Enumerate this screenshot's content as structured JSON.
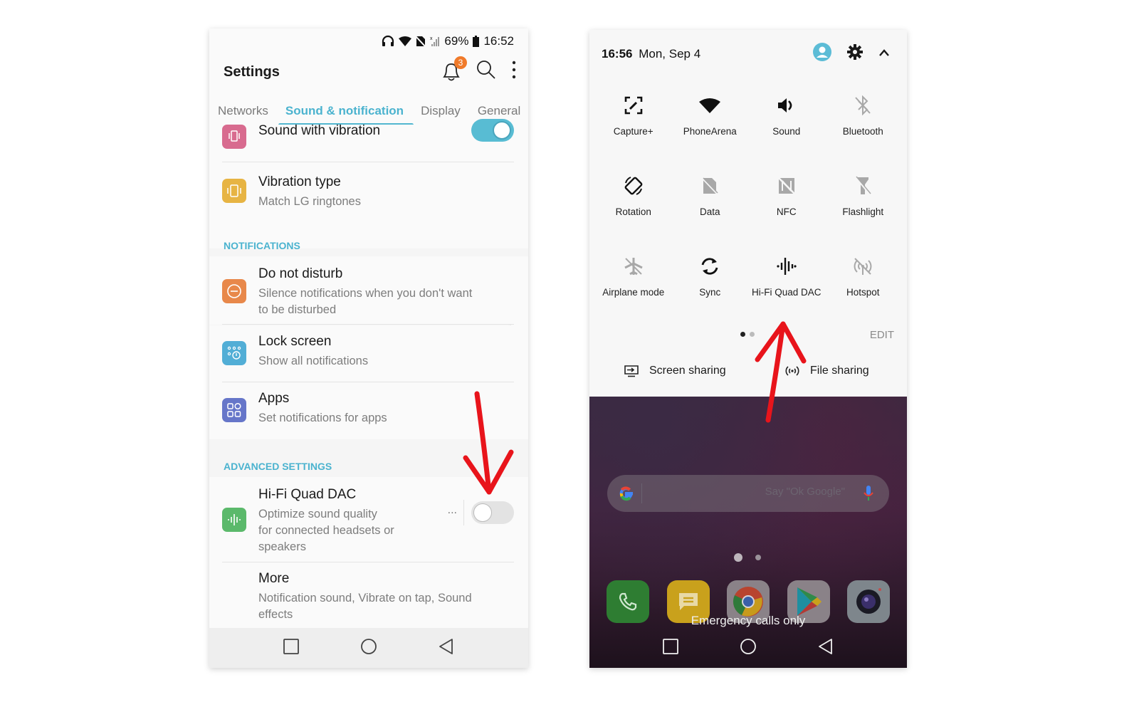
{
  "left_phone": {
    "status_bar": {
      "battery": "69%",
      "time": "16:52"
    },
    "app_bar": {
      "title": "Settings",
      "notification_count": "3"
    },
    "tabs": [
      {
        "label": "Networks",
        "active": false
      },
      {
        "label": "Sound & notification",
        "active": true
      },
      {
        "label": "Display",
        "active": false
      },
      {
        "label": "General",
        "active": false
      }
    ],
    "items": {
      "sound_with_vibration": {
        "title": "Sound with vibration",
        "toggle": "on",
        "icon_color": "#d86b8f"
      },
      "vibration_type": {
        "title": "Vibration type",
        "subtitle": "Match LG ringtones",
        "icon_color": "#e7b443"
      },
      "do_not_disturb": {
        "title": "Do not disturb",
        "subtitle_line1": "Silence notifications when you don't want",
        "subtitle_line2": "to be disturbed",
        "icon_color": "#e8884a"
      },
      "lock_screen": {
        "title": "Lock screen",
        "subtitle": "Show all notifications",
        "icon_color": "#52aed6"
      },
      "apps": {
        "title": "Apps",
        "subtitle": "Set notifications for apps",
        "icon_color": "#6676c9"
      },
      "hifi_dac": {
        "title": "Hi-Fi Quad DAC",
        "subtitle_line1": "Optimize sound quality",
        "subtitle_line2": "for connected headsets or",
        "subtitle_line3": "speakers",
        "more": "...",
        "toggle": "off",
        "icon_color": "#5bb96b"
      },
      "more": {
        "title": "More",
        "subtitle_line1": "Notification sound, Vibrate on tap, Sound",
        "subtitle_line2": "effects"
      }
    },
    "sections": {
      "notifications": "NOTIFICATIONS",
      "advanced": "ADVANCED SETTINGS"
    }
  },
  "right_phone": {
    "header": {
      "time": "16:56",
      "date": "Mon, Sep 4"
    },
    "tiles": [
      {
        "label": "Capture+",
        "icon": "capture-plus-icon",
        "active": true
      },
      {
        "label": "PhoneArena",
        "icon": "wifi-icon",
        "active": true
      },
      {
        "label": "Sound",
        "icon": "volume-icon",
        "active": true
      },
      {
        "label": "Bluetooth",
        "icon": "bluetooth-off-icon",
        "active": false
      },
      {
        "label": "Rotation",
        "icon": "rotation-icon",
        "active": true
      },
      {
        "label": "Data",
        "icon": "data-off-icon",
        "active": false
      },
      {
        "label": "NFC",
        "icon": "nfc-off-icon",
        "active": false
      },
      {
        "label": "Flashlight",
        "icon": "flashlight-off-icon",
        "active": false
      },
      {
        "label": "Airplane mode",
        "icon": "airplane-off-icon",
        "active": false
      },
      {
        "label": "Sync",
        "icon": "sync-icon",
        "active": true
      },
      {
        "label": "Hi-Fi Quad DAC",
        "icon": "hifi-dac-icon",
        "active": true
      },
      {
        "label": "Hotspot",
        "icon": "hotspot-off-icon",
        "active": false
      }
    ],
    "pager": {
      "current": 1,
      "total": 2
    },
    "edit_label": "EDIT",
    "share": {
      "screen": "Screen sharing",
      "file": "File sharing"
    },
    "home": {
      "search_placeholder": "Say \"Ok Google\"",
      "emergency": "Emergency calls only",
      "dock": [
        "Phone",
        "Messages",
        "Chrome",
        "Play Store",
        "Camera"
      ]
    }
  },
  "colors": {
    "accent": "#4bb3cf",
    "annotation": "#e8141b"
  }
}
